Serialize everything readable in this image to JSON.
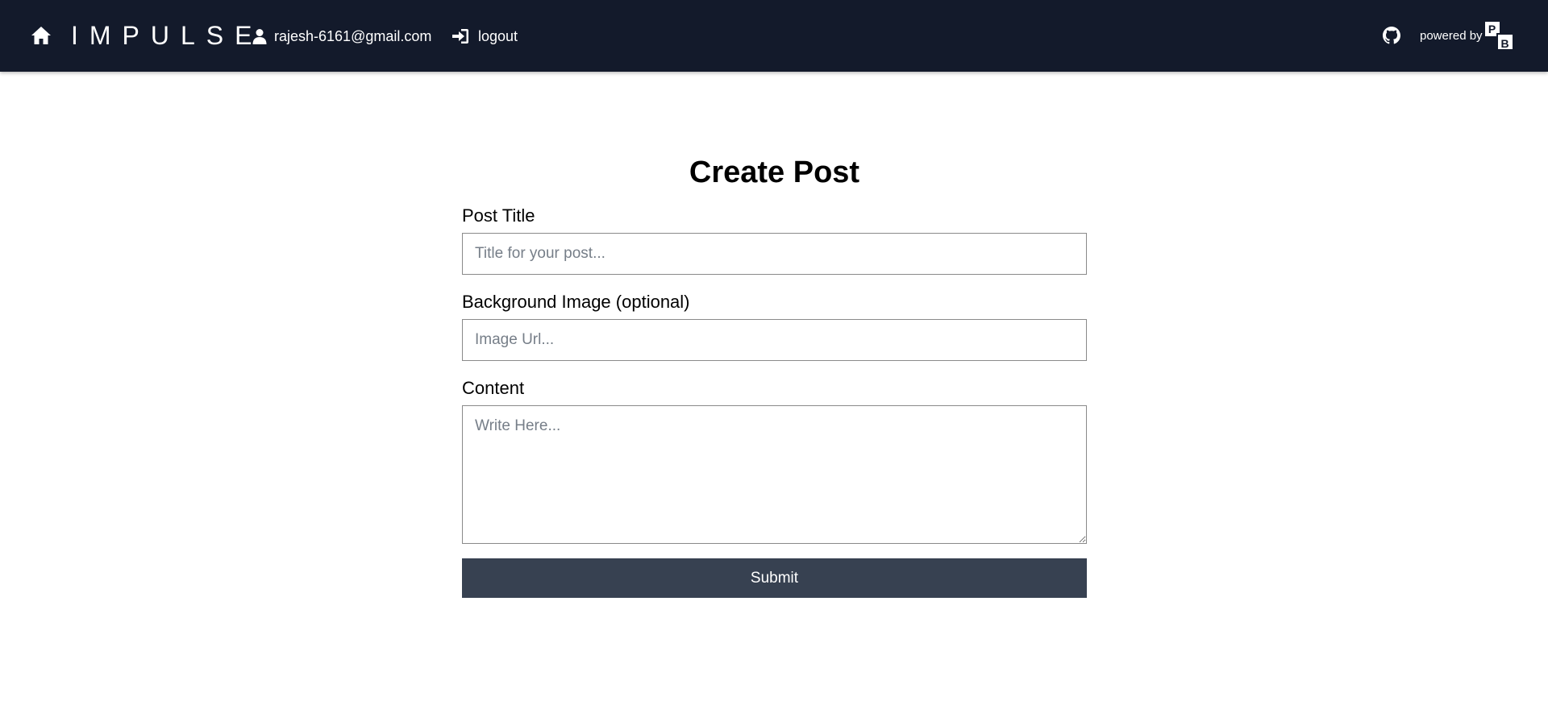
{
  "header": {
    "home_icon": "home-icon",
    "brand": "IMPULSE",
    "user_icon": "user-icon",
    "user_email": "rajesh-6161@gmail.com",
    "logout_icon": "sign-in-icon",
    "logout_label": "logout",
    "github_icon": "github-icon",
    "powered_by_label": "powered by",
    "logo_letters": [
      "P",
      "B"
    ],
    "background_color": "#131a2b"
  },
  "form": {
    "heading": "Create Post",
    "title_label": "Post Title",
    "title_placeholder": "Title for your post...",
    "title_value": "",
    "image_label": "Background Image (optional)",
    "image_placeholder": "Image Url...",
    "image_value": "",
    "content_label": "Content",
    "content_placeholder": "Write Here...",
    "content_value": "",
    "submit_label": "Submit",
    "submit_color": "#374151"
  }
}
